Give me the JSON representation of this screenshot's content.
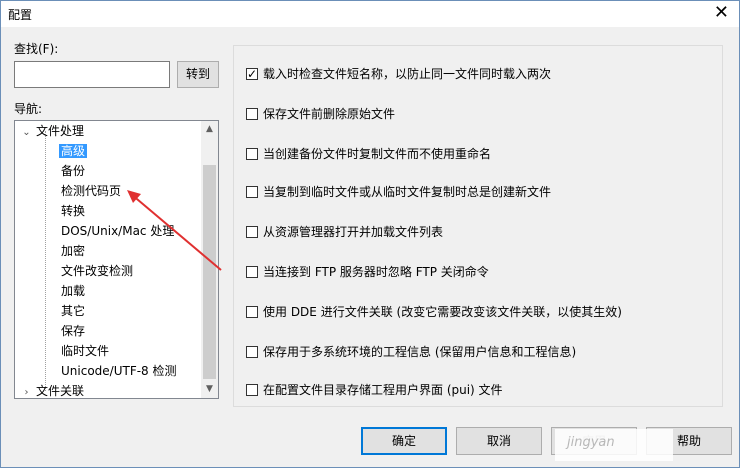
{
  "window": {
    "title": "配置",
    "close_glyph": "✕"
  },
  "search": {
    "label": "查找(F):",
    "value": "",
    "go_button": "转到"
  },
  "nav": {
    "label": "导航:",
    "tree": [
      {
        "label": "文件处理",
        "level": 0,
        "expanded": true
      },
      {
        "label": "高级",
        "level": 1,
        "selected": true
      },
      {
        "label": "备份",
        "level": 1
      },
      {
        "label": "检测代码页",
        "level": 1
      },
      {
        "label": "转换",
        "level": 1
      },
      {
        "label": "DOS/Unix/Mac 处理",
        "level": 1
      },
      {
        "label": "加密",
        "level": 1
      },
      {
        "label": "文件改变检测",
        "level": 1
      },
      {
        "label": "加载",
        "level": 1
      },
      {
        "label": "其它",
        "level": 1
      },
      {
        "label": "保存",
        "level": 1
      },
      {
        "label": "临时文件",
        "level": 1
      },
      {
        "label": "Unicode/UTF-8 检测",
        "level": 1
      },
      {
        "label": "文件关联",
        "level": 0,
        "expanded": false
      }
    ]
  },
  "options": [
    {
      "label": "载入时检查文件短名称，以防止同一文件同时载入两次",
      "checked": true
    },
    {
      "label": "保存文件前删除原始文件",
      "checked": false
    },
    {
      "label": "当创建备份文件时复制文件而不使用重命名",
      "checked": false
    },
    {
      "label": "当复制到临时文件或从临时文件复制时总是创建新文件",
      "checked": false
    },
    {
      "label": "从资源管理器打开并加载文件列表",
      "checked": false
    },
    {
      "label": "当连接到 FTP 服务器时忽略 FTP 关闭命令",
      "checked": false
    },
    {
      "label": "使用 DDE 进行文件关联 (改变它需要改变该文件关联，以使其生效)",
      "checked": false
    },
    {
      "label": "保存用于多系统环境的工程信息 (保留用户信息和工程信息)",
      "checked": false
    },
    {
      "label": "在配置文件目录存储工程用户界面 (pui) 文件",
      "checked": false
    }
  ],
  "buttons": {
    "ok": "确定",
    "cancel": "取消",
    "apply": "应用",
    "help": "帮助"
  },
  "watermark": "jingyan",
  "colors": {
    "selection": "#3399ff",
    "default_button_border": "#0078d7",
    "annotation_arrow": "#e03030"
  }
}
